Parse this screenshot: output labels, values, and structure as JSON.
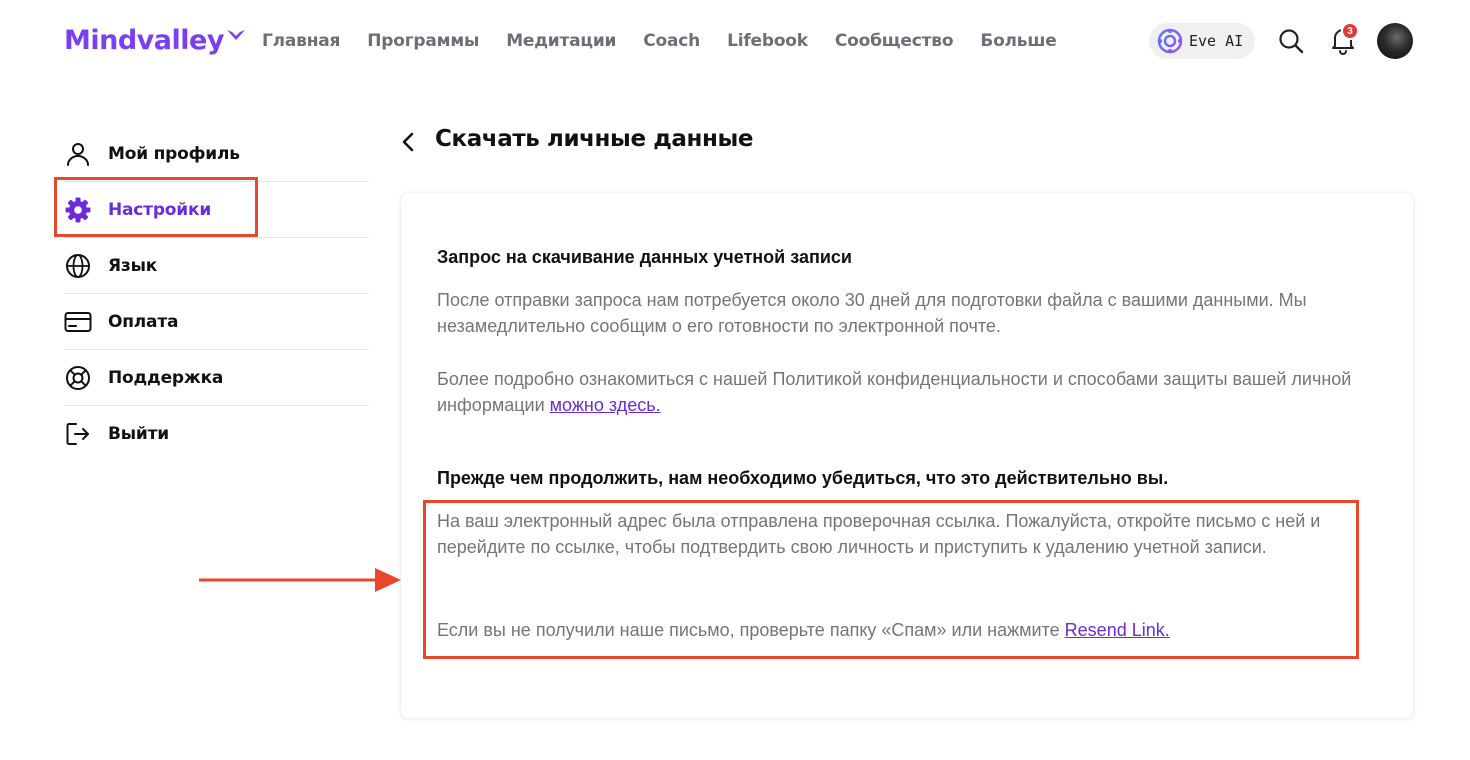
{
  "header": {
    "logo_text": "Mindvalley",
    "nav": [
      "Главная",
      "Программы",
      "Медитации",
      "Coach",
      "Lifebook",
      "Сообщество",
      "Больше"
    ],
    "eve_label": "Eve AI",
    "notification_count": "3",
    "accent_color": "#7a3ff2"
  },
  "sidebar": {
    "items": [
      {
        "label": "Мой профиль",
        "icon": "user-icon"
      },
      {
        "label": "Настройки",
        "icon": "gear-icon",
        "active": true
      },
      {
        "label": "Язык",
        "icon": "globe-icon"
      },
      {
        "label": "Оплата",
        "icon": "credit-card-icon"
      },
      {
        "label": "Поддержка",
        "icon": "lifebuoy-icon"
      },
      {
        "label": "Выйти",
        "icon": "logout-icon"
      }
    ]
  },
  "main": {
    "title": "Скачать личные данные",
    "section1": {
      "title": "Запрос на скачивание данных учетной записи",
      "para1": "После отправки запроса нам потребуется около 30 дней для подготовки файла с вашими данными. Мы незамедлительно сообщим о его готовности по электронной почте.",
      "para2": "Более подробно ознакомиться с нашей Политикой конфиденциальности и способами защиты вашей личной информации",
      "para2_link": "можно здесь."
    },
    "section2": {
      "title": "Прежде чем продолжить, нам необходимо убедиться, что это действительно вы.",
      "para1": "На ваш электронный адрес была отправлена проверочная ссылка. Пожалуйста, откройте письмо с ней и перейдите по ссылке, чтобы подтвердить свою личность и приступить к удалению учетной записи.",
      "para2": "Если вы не получили наше письмо, проверьте папку «Спам» или нажмите",
      "resend_link": "Resend Link."
    }
  },
  "colors": {
    "highlight": "#e9472a",
    "link": "#6b2bd9",
    "muted_text": "#74757c"
  }
}
